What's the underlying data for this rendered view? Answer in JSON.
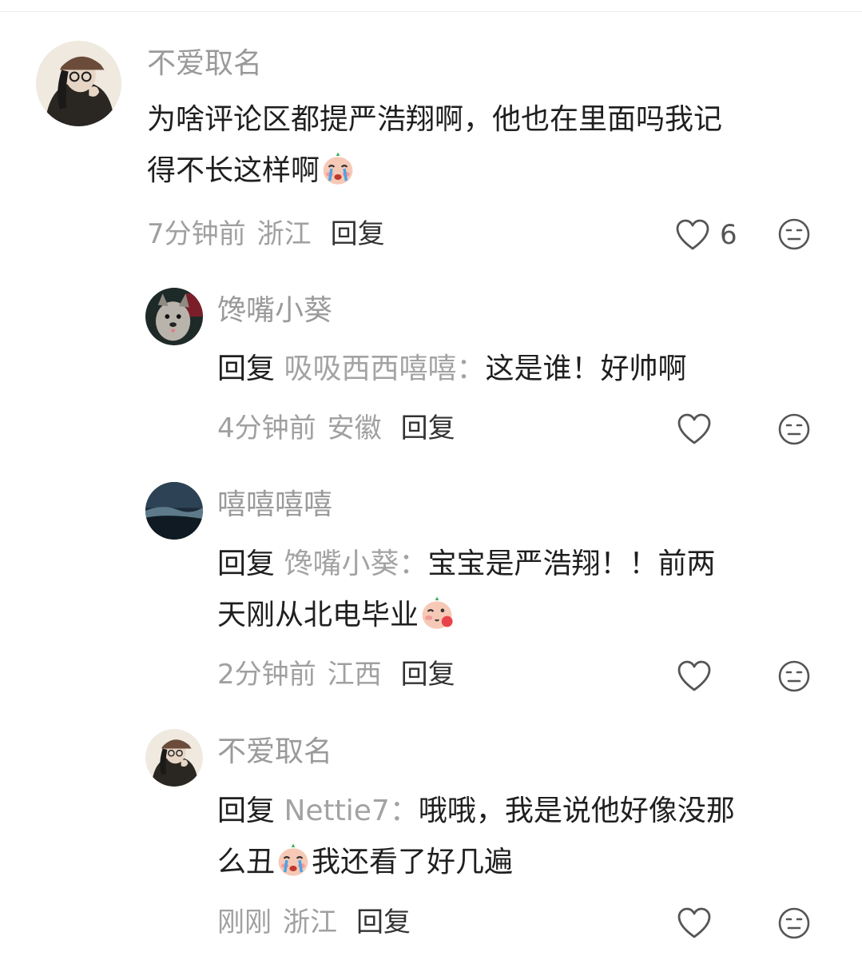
{
  "comments": [
    {
      "username": "不爱取名",
      "text_before": "为啥评论区都提严浩翔啊，他也在里面吗我记",
      "text_line2": "得不长这样啊",
      "emoji": "crying-face-emoji",
      "time": "7分钟前",
      "location": "浙江",
      "reply_label": "回复",
      "likes": "6",
      "avatar": "girl-with-cap-avatar"
    },
    {
      "username": "馋嘴小葵",
      "reply_prefix": "回复",
      "reply_target": "吸吸西西嘻嘻：",
      "text": "这是谁！好帅啊",
      "time": "4分钟前",
      "location": "安徽",
      "reply_label": "回复",
      "avatar": "dog-avatar"
    },
    {
      "username": "嘻嘻嘻嘻",
      "reply_prefix": "回复",
      "reply_target": "馋嘴小葵：",
      "text": "宝宝是严浩翔！！前两",
      "text_line2": "天刚从北电毕业",
      "emoji": "shy-kiss-emoji",
      "time": "2分钟前",
      "location": "江西",
      "reply_label": "回复",
      "avatar": "dark-landscape-avatar"
    },
    {
      "username": "不爱取名",
      "reply_prefix": "回复",
      "reply_target": "Nettie7：",
      "text": "哦哦，我是说他好像没那",
      "text_line2_a": "么丑",
      "text_line2_b": "我还看了好几遍",
      "emoji": "crying-face-emoji",
      "time": "刚刚",
      "location": "浙江",
      "reply_label": "回复",
      "avatar": "girl-with-cap-avatar"
    }
  ],
  "icons": {
    "like": "heart-outline-icon",
    "dislike": "neutral-face-icon"
  },
  "colors": {
    "username": "#9a9a9a",
    "meta": "#a0a0a0",
    "text": "#1f1f1f"
  }
}
